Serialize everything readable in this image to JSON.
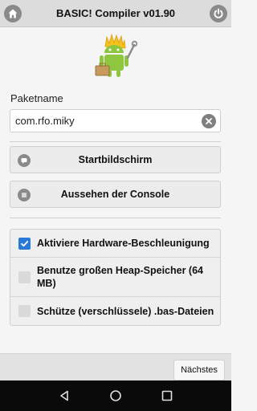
{
  "header": {
    "title": "BASIC! Compiler v01.90",
    "left_icon": "home-icon",
    "right_icon": "power-icon"
  },
  "package": {
    "label": "Paketname",
    "value": "com.rfo.miky",
    "clear_icon": "clear-icon"
  },
  "buttons": {
    "home_screen": "Startbildschirm",
    "console_look": "Aussehen der Console"
  },
  "options": [
    {
      "label": "Aktiviere Hardware-Beschleunigung",
      "checked": true
    },
    {
      "label": "Benutze großen Heap-Speicher (64 MB)",
      "checked": false
    },
    {
      "label": "Schütze (verschlüssele) .bas-Dateien",
      "checked": false
    }
  ],
  "footer": {
    "next_label": "Nächstes"
  },
  "colors": {
    "header_bg": "#dcdcdc",
    "checkbox_on": "#2979d6",
    "icon_gray": "#8a8a8a",
    "navbar_bg": "#0a0a0a"
  }
}
